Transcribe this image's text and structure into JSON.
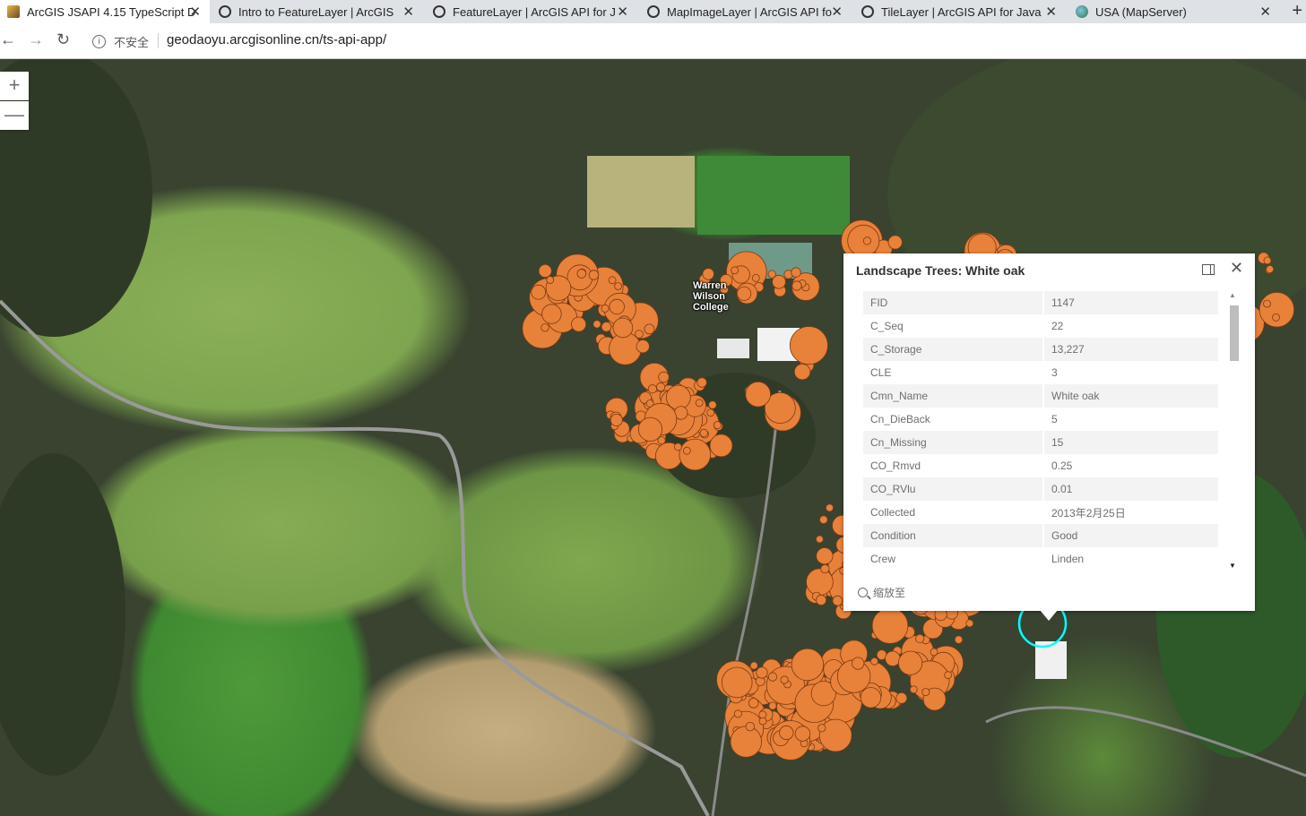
{
  "browser": {
    "tabs": [
      {
        "title": "ArcGIS JSAPI 4.15 TypeScript D",
        "active": true
      },
      {
        "title": "Intro to FeatureLayer | ArcGIS"
      },
      {
        "title": "FeatureLayer | ArcGIS API for J"
      },
      {
        "title": "MapImageLayer | ArcGIS API fo"
      },
      {
        "title": "TileLayer | ArcGIS API for Java"
      },
      {
        "title": "USA (MapServer)"
      }
    ],
    "close_glyph": "✕",
    "new_tab_glyph": "+",
    "security_label": "不安全",
    "url": "geodaoyu.arcgisonline.cn/ts-api-app/"
  },
  "map": {
    "zoom_in": "+",
    "zoom_out": "—",
    "place_label": "Warren Wilson College",
    "feature_color": "#e8813a",
    "selection_color": "#00ffff"
  },
  "popup": {
    "title": "Landscape Trees: White oak",
    "fields": [
      {
        "key": "FID",
        "value": "1147"
      },
      {
        "key": "C_Seq",
        "value": "22"
      },
      {
        "key": "C_Storage",
        "value": "13,227"
      },
      {
        "key": "CLE",
        "value": "3"
      },
      {
        "key": "Cmn_Name",
        "value": "White oak"
      },
      {
        "key": "Cn_DieBack",
        "value": "5"
      },
      {
        "key": "Cn_Missing",
        "value": "15"
      },
      {
        "key": "CO_Rmvd",
        "value": "0.25"
      },
      {
        "key": "CO_RVlu",
        "value": "0.01"
      },
      {
        "key": "Collected",
        "value": "2013年2月25日"
      },
      {
        "key": "Condition",
        "value": "Good"
      },
      {
        "key": "Crew",
        "value": "Linden"
      }
    ],
    "zoom_to_label": "缩放至"
  }
}
